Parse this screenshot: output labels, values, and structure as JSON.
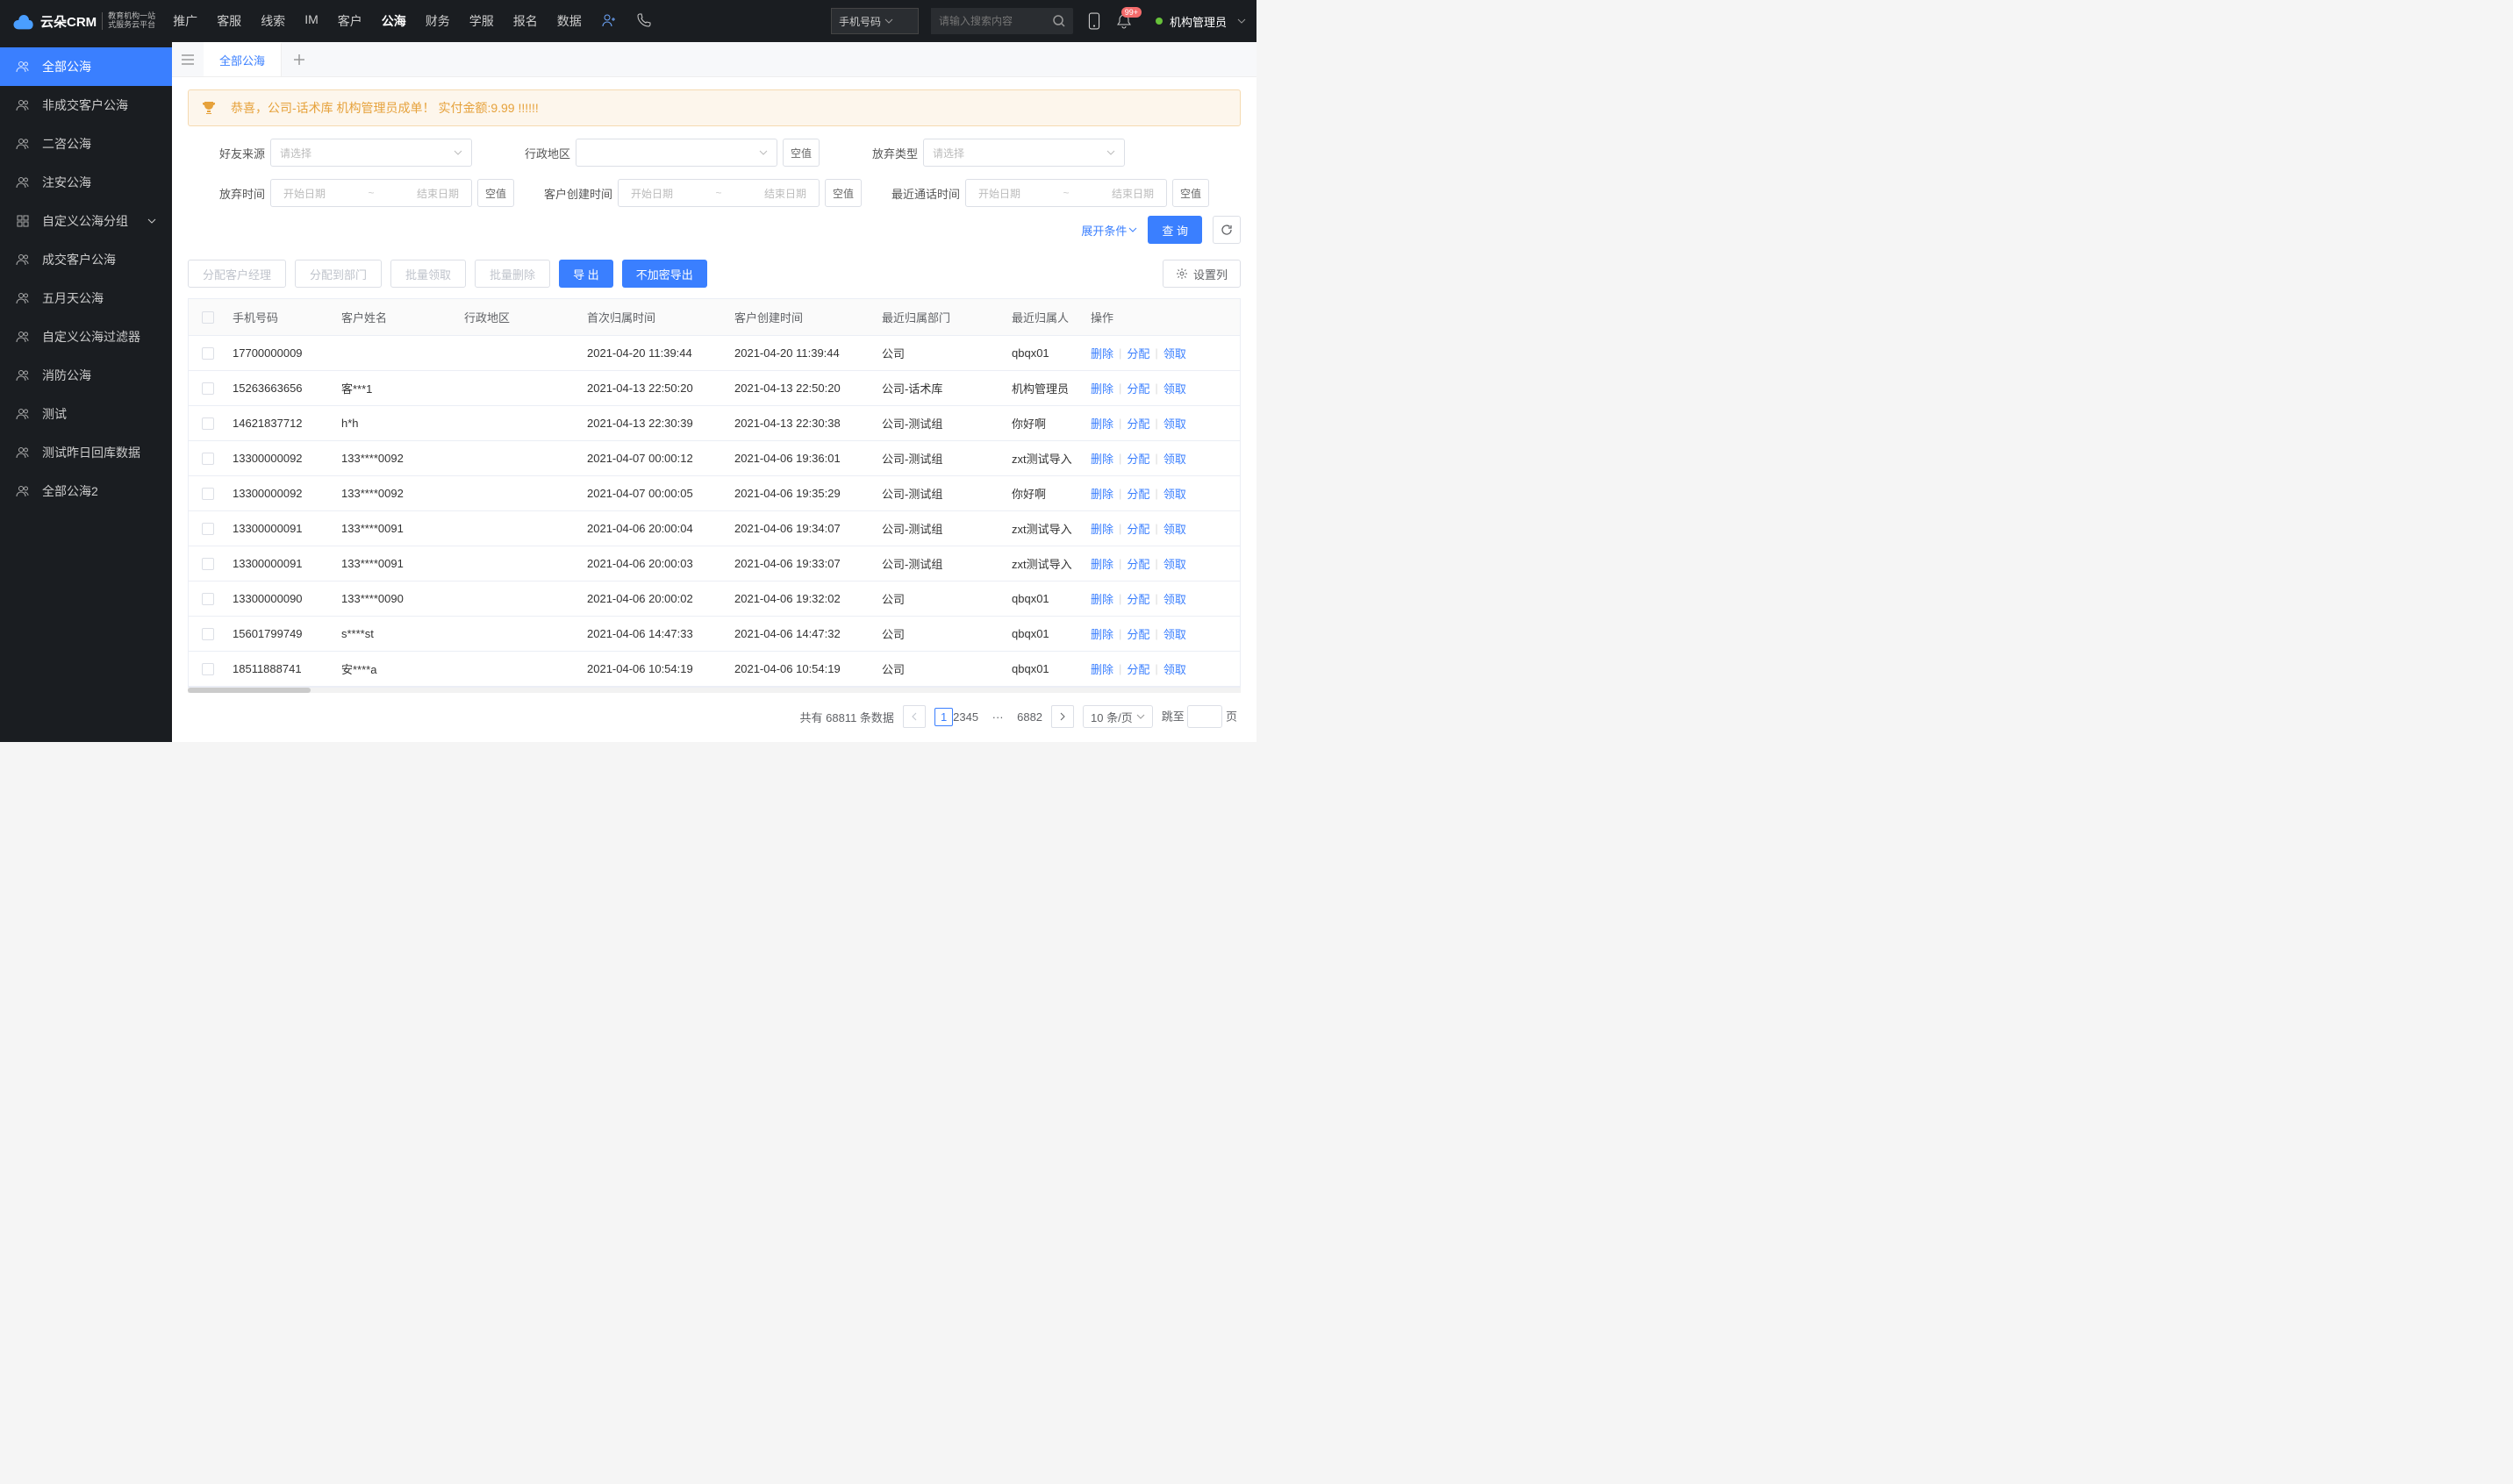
{
  "logo": {
    "brand": "云朵CRM",
    "sub1": "教育机构一站",
    "sub2": "式服务云平台",
    "url": "www.yunduocrm.com"
  },
  "topnav": [
    "推广",
    "客服",
    "线索",
    "IM",
    "客户",
    "公海",
    "财务",
    "学服",
    "报名",
    "数据"
  ],
  "topnav_active": 5,
  "search": {
    "select": "手机号码",
    "placeholder": "请输入搜索内容"
  },
  "notif_badge": "99+",
  "user": "机构管理员",
  "sidebar": [
    {
      "label": "全部公海",
      "active": true,
      "icon": "customer"
    },
    {
      "label": "非成交客户公海",
      "icon": "customer"
    },
    {
      "label": "二咨公海",
      "icon": "customer"
    },
    {
      "label": "注安公海",
      "icon": "customer"
    },
    {
      "label": "自定义公海分组",
      "icon": "group",
      "expandable": true
    },
    {
      "label": "成交客户公海",
      "icon": "customer"
    },
    {
      "label": "五月天公海",
      "icon": "customer"
    },
    {
      "label": "自定义公海过滤器",
      "icon": "customer"
    },
    {
      "label": "消防公海",
      "icon": "customer"
    },
    {
      "label": "测试",
      "icon": "customer"
    },
    {
      "label": "测试昨日回库数据",
      "icon": "customer"
    },
    {
      "label": "全部公海2",
      "icon": "customer"
    }
  ],
  "tabs": {
    "current": "全部公海"
  },
  "banner": "恭喜，公司-话术库  机构管理员成单！  实付金额:9.99 !!!!!!",
  "filters": {
    "friend_source": {
      "label": "好友来源",
      "placeholder": "请选择"
    },
    "admin_region": {
      "label": "行政地区",
      "null_btn": "空值"
    },
    "abandon_type": {
      "label": "放弃类型",
      "placeholder": "请选择"
    },
    "abandon_time": {
      "label": "放弃时间",
      "start": "开始日期",
      "end": "结束日期",
      "null_btn": "空值"
    },
    "customer_create": {
      "label": "客户创建时间",
      "start": "开始日期",
      "end": "结束日期",
      "null_btn": "空值"
    },
    "last_call": {
      "label": "最近通话时间",
      "start": "开始日期",
      "end": "结束日期",
      "null_btn": "空值"
    }
  },
  "expand_link": "展开条件",
  "query_btn": "查 询",
  "actions": {
    "assign_mgr": "分配客户经理",
    "assign_dept": "分配到部门",
    "batch_claim": "批量领取",
    "batch_delete": "批量删除",
    "export": "导 出",
    "export_nomask": "不加密导出",
    "set_cols": "设置列"
  },
  "columns": [
    "手机号码",
    "客户姓名",
    "行政地区",
    "首次归属时间",
    "客户创建时间",
    "最近归属部门",
    "最近归属人",
    "操作"
  ],
  "rows": [
    {
      "phone": "17700000009",
      "name": "",
      "region": "",
      "first": "2021-04-20 11:39:44",
      "create": "2021-04-20 11:39:44",
      "dept": "公司",
      "person": "qbqx01"
    },
    {
      "phone": "15263663656",
      "name": "客***1",
      "region": "",
      "first": "2021-04-13 22:50:20",
      "create": "2021-04-13 22:50:20",
      "dept": "公司-话术库",
      "person": "机构管理员"
    },
    {
      "phone": "14621837712",
      "name": "h*h",
      "region": "",
      "first": "2021-04-13 22:30:39",
      "create": "2021-04-13 22:30:38",
      "dept": "公司-测试组",
      "person": "你好啊"
    },
    {
      "phone": "13300000092",
      "name": "133****0092",
      "region": "",
      "first": "2021-04-07 00:00:12",
      "create": "2021-04-06 19:36:01",
      "dept": "公司-测试组",
      "person": "zxt测试导入"
    },
    {
      "phone": "13300000092",
      "name": "133****0092",
      "region": "",
      "first": "2021-04-07 00:00:05",
      "create": "2021-04-06 19:35:29",
      "dept": "公司-测试组",
      "person": "你好啊"
    },
    {
      "phone": "13300000091",
      "name": "133****0091",
      "region": "",
      "first": "2021-04-06 20:00:04",
      "create": "2021-04-06 19:34:07",
      "dept": "公司-测试组",
      "person": "zxt测试导入"
    },
    {
      "phone": "13300000091",
      "name": "133****0091",
      "region": "",
      "first": "2021-04-06 20:00:03",
      "create": "2021-04-06 19:33:07",
      "dept": "公司-测试组",
      "person": "zxt测试导入"
    },
    {
      "phone": "13300000090",
      "name": "133****0090",
      "region": "",
      "first": "2021-04-06 20:00:02",
      "create": "2021-04-06 19:32:02",
      "dept": "公司",
      "person": "qbqx01"
    },
    {
      "phone": "15601799749",
      "name": "s****st",
      "region": "",
      "first": "2021-04-06 14:47:33",
      "create": "2021-04-06 14:47:32",
      "dept": "公司",
      "person": "qbqx01"
    },
    {
      "phone": "18511888741",
      "name": "安****a",
      "region": "",
      "first": "2021-04-06 10:54:19",
      "create": "2021-04-06 10:54:19",
      "dept": "公司",
      "person": "qbqx01"
    }
  ],
  "row_ops": {
    "del": "删除",
    "assign": "分配",
    "claim": "领取"
  },
  "pagination": {
    "total_prefix": "共有",
    "total": "68811",
    "total_suffix": "条数据",
    "pages": [
      "1",
      "2",
      "3",
      "4",
      "5"
    ],
    "ellipsis": "···",
    "last": "6882",
    "per_page": "10 条/页",
    "jump_prefix": "跳至",
    "jump_suffix": "页"
  }
}
